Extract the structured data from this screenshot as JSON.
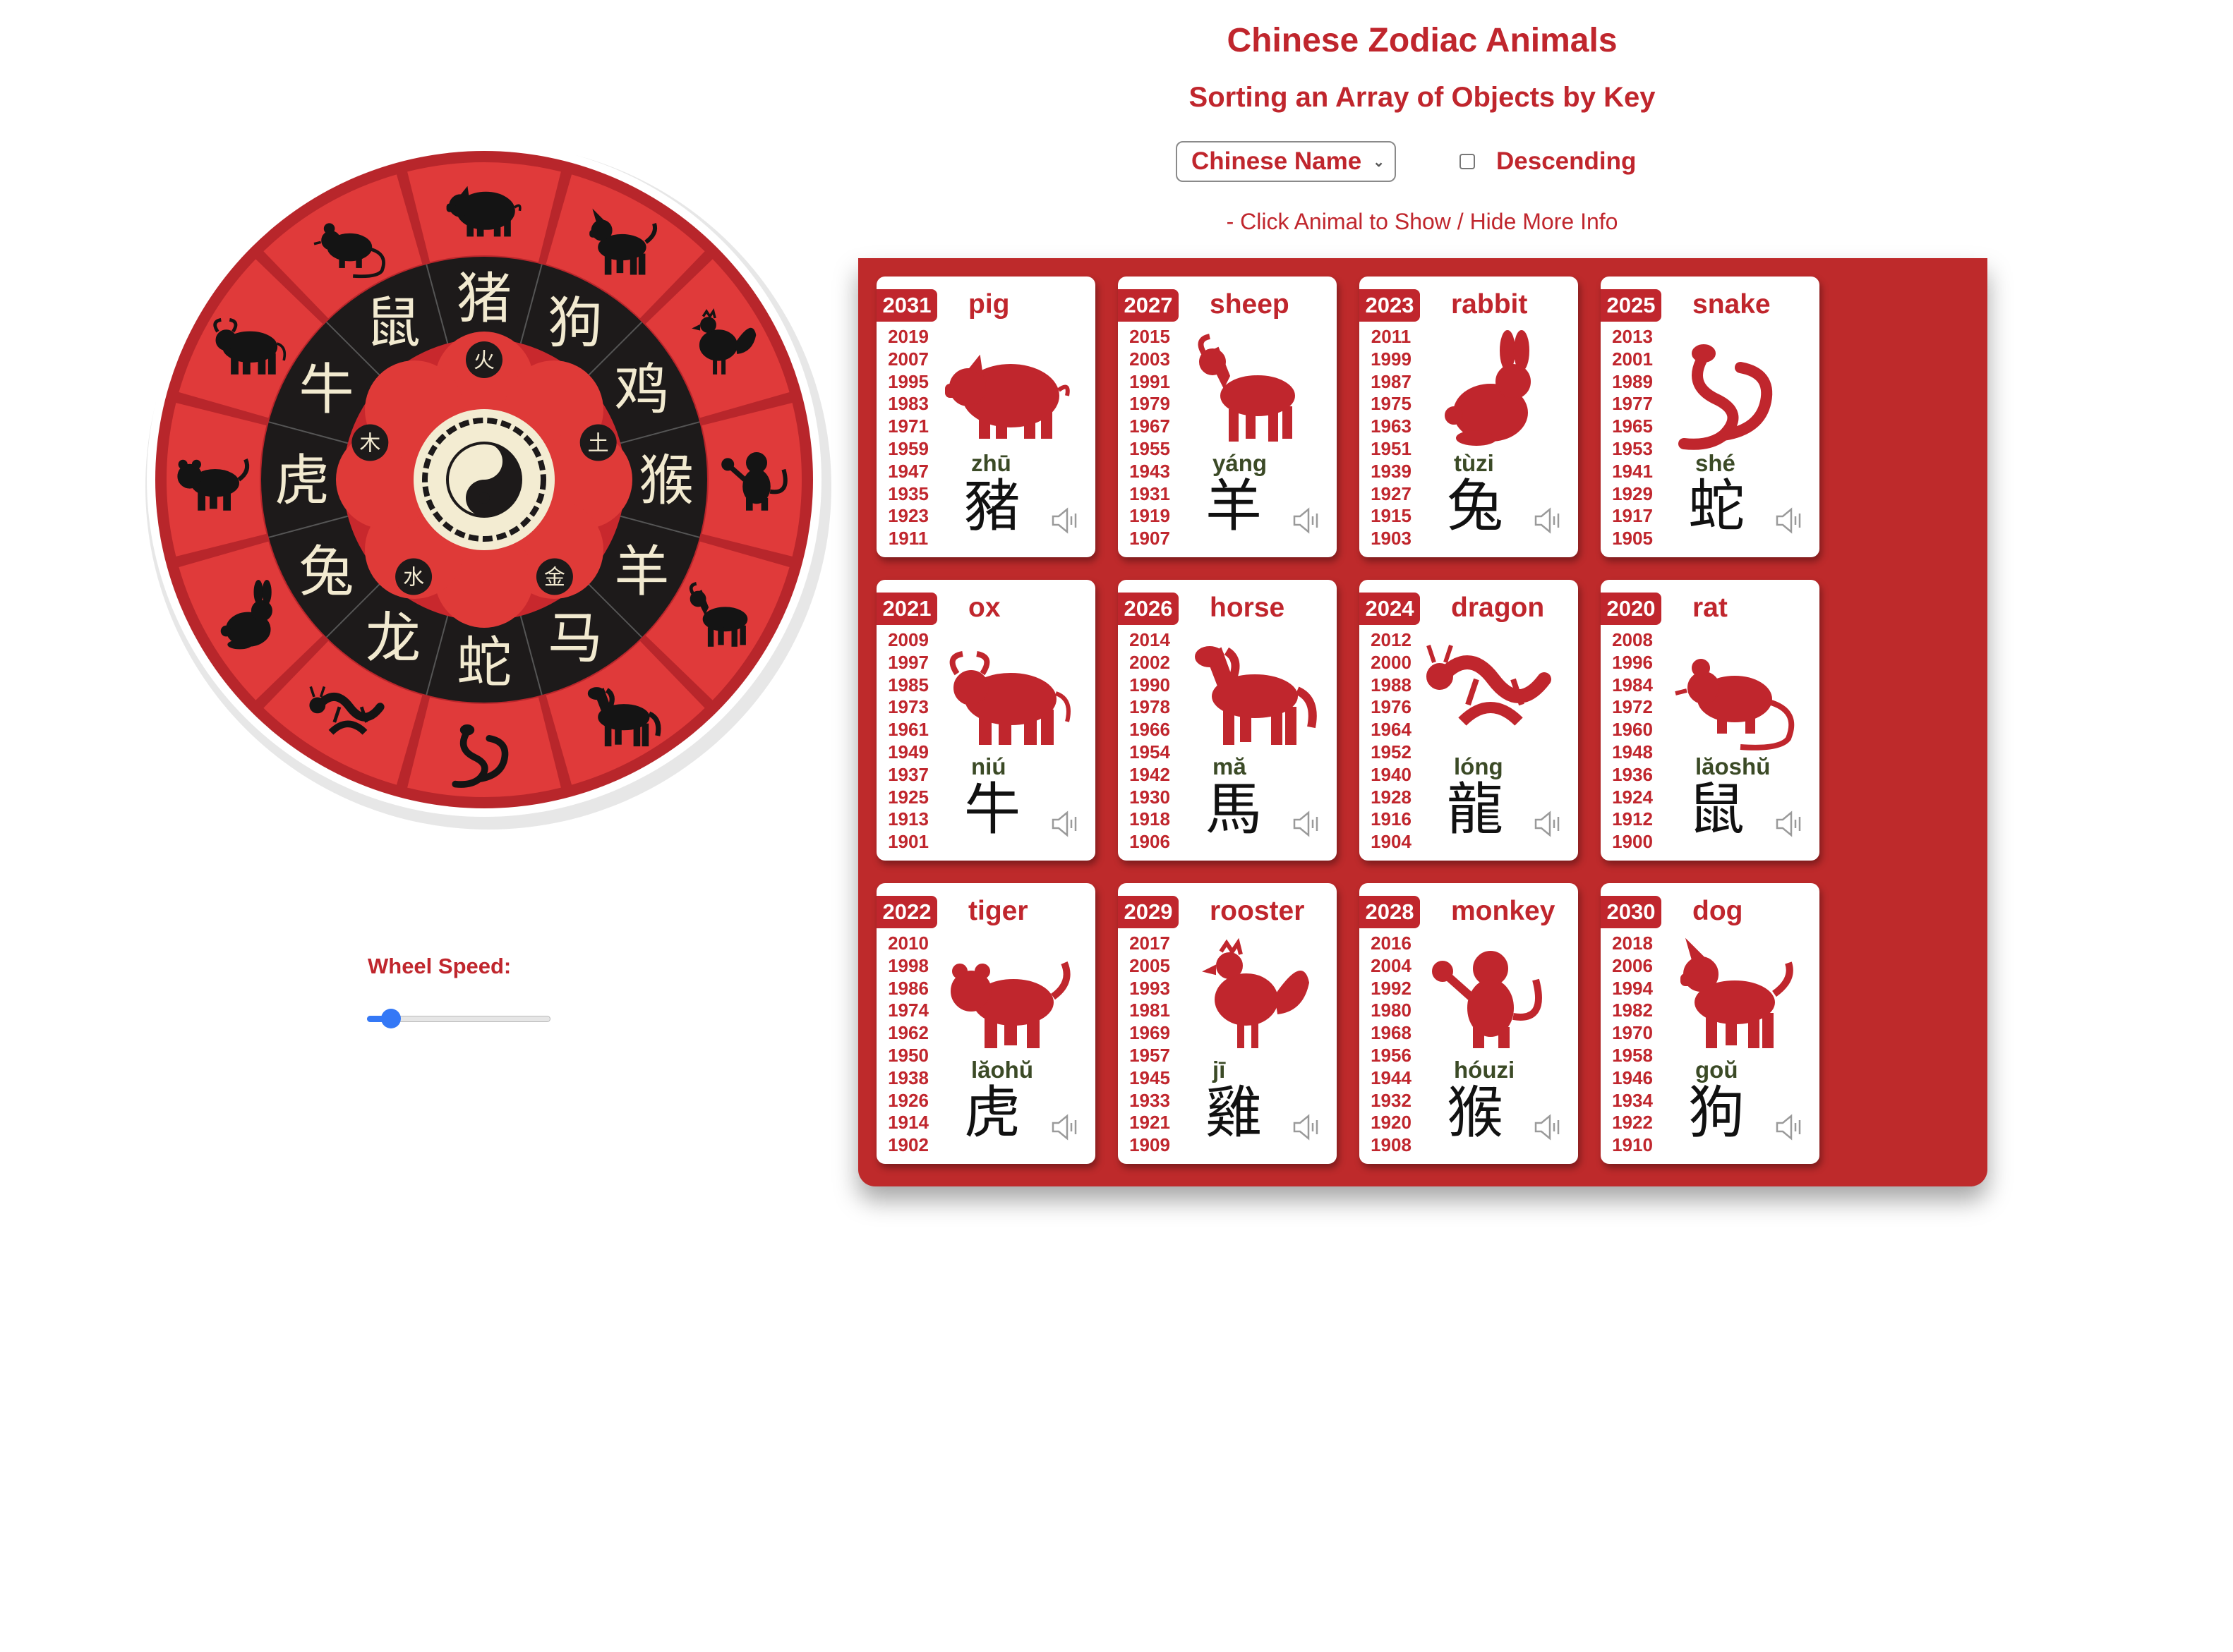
{
  "page": {
    "title": "Chinese Zodiac Animals",
    "subtitle": "Sorting an Array of Objects by Key",
    "hint": "- Click Animal to Show / Hide More Info"
  },
  "controls": {
    "sort_selected": "Chinese Name",
    "descending_label": "Descending",
    "descending_checked": false
  },
  "speed": {
    "label": "Wheel Speed:",
    "value": 0.13
  },
  "colors": {
    "accent": "#c0262d",
    "panel": "#be2a2b",
    "slider": "#3478f6",
    "pinyin": "#3b4a26"
  },
  "wheel": {
    "animal_chars": [
      "猪",
      "狗",
      "鸡",
      "猴",
      "羊",
      "马",
      "蛇",
      "龙",
      "兔",
      "虎",
      "牛",
      "鼠"
    ],
    "element_chars": [
      "火",
      "土",
      "金",
      "水",
      "木"
    ],
    "outer_icons": [
      "pig-icon",
      "dog-icon",
      "rooster-icon",
      "monkey-icon",
      "sheep-icon",
      "horse-icon",
      "snake-icon",
      "dragon-icon",
      "rabbit-icon",
      "tiger-icon",
      "ox-icon",
      "rat-icon"
    ]
  },
  "cards": [
    {
      "name": "pig",
      "year": "2031",
      "pinyin": "zhū",
      "hanzi": "豬",
      "years": [
        "2019",
        "2007",
        "1995",
        "1983",
        "1971",
        "1959",
        "1947",
        "1935",
        "1923",
        "1911"
      ]
    },
    {
      "name": "sheep",
      "year": "2027",
      "pinyin": "yáng",
      "hanzi": "羊",
      "years": [
        "2015",
        "2003",
        "1991",
        "1979",
        "1967",
        "1955",
        "1943",
        "1931",
        "1919",
        "1907"
      ]
    },
    {
      "name": "rabbit",
      "year": "2023",
      "pinyin": "tùzi",
      "hanzi": "兔",
      "years": [
        "2011",
        "1999",
        "1987",
        "1975",
        "1963",
        "1951",
        "1939",
        "1927",
        "1915",
        "1903"
      ]
    },
    {
      "name": "snake",
      "year": "2025",
      "pinyin": "shé",
      "hanzi": "蛇",
      "years": [
        "2013",
        "2001",
        "1989",
        "1977",
        "1965",
        "1953",
        "1941",
        "1929",
        "1917",
        "1905"
      ]
    },
    {
      "name": "ox",
      "year": "2021",
      "pinyin": "niú",
      "hanzi": "牛",
      "years": [
        "2009",
        "1997",
        "1985",
        "1973",
        "1961",
        "1949",
        "1937",
        "1925",
        "1913",
        "1901"
      ]
    },
    {
      "name": "horse",
      "year": "2026",
      "pinyin": "mă",
      "hanzi": "馬",
      "years": [
        "2014",
        "2002",
        "1990",
        "1978",
        "1966",
        "1954",
        "1942",
        "1930",
        "1918",
        "1906"
      ]
    },
    {
      "name": "dragon",
      "year": "2024",
      "pinyin": "lóng",
      "hanzi": "龍",
      "years": [
        "2012",
        "2000",
        "1988",
        "1976",
        "1964",
        "1952",
        "1940",
        "1928",
        "1916",
        "1904"
      ]
    },
    {
      "name": "rat",
      "year": "2020",
      "pinyin": "lăoshŭ",
      "hanzi": "鼠",
      "years": [
        "2008",
        "1996",
        "1984",
        "1972",
        "1960",
        "1948",
        "1936",
        "1924",
        "1912",
        "1900"
      ]
    },
    {
      "name": "tiger",
      "year": "2022",
      "pinyin": "lăohŭ",
      "hanzi": "虎",
      "years": [
        "2010",
        "1998",
        "1986",
        "1974",
        "1962",
        "1950",
        "1938",
        "1926",
        "1914",
        "1902"
      ]
    },
    {
      "name": "rooster",
      "year": "2029",
      "pinyin": "jī",
      "hanzi": "雞",
      "years": [
        "2017",
        "2005",
        "1993",
        "1981",
        "1969",
        "1957",
        "1945",
        "1933",
        "1921",
        "1909"
      ]
    },
    {
      "name": "monkey",
      "year": "2028",
      "pinyin": "hóuzi",
      "hanzi": "猴",
      "years": [
        "2016",
        "2004",
        "1992",
        "1980",
        "1968",
        "1956",
        "1944",
        "1932",
        "1920",
        "1908"
      ]
    },
    {
      "name": "dog",
      "year": "2030",
      "pinyin": "goŭ",
      "hanzi": "狗",
      "years": [
        "2018",
        "2006",
        "1994",
        "1982",
        "1970",
        "1958",
        "1946",
        "1934",
        "1922",
        "1910"
      ]
    }
  ]
}
